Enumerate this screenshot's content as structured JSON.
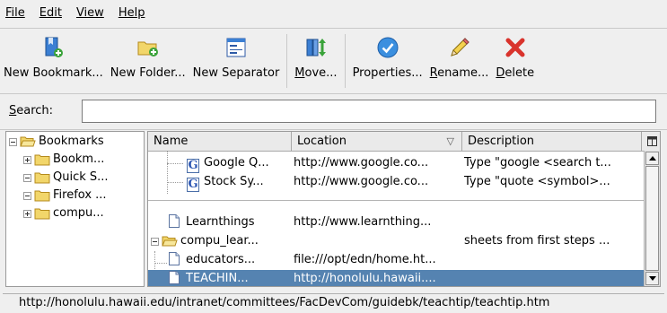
{
  "menubar": {
    "file": "File",
    "edit": "Edit",
    "view": "View",
    "help": "Help"
  },
  "toolbar": {
    "new_bookmark": "New Bookmark...",
    "new_folder": "New Folder...",
    "new_separator": "New Separator",
    "move": "Move...",
    "properties": "Properties...",
    "rename": "Rename...",
    "delete": "Delete"
  },
  "search": {
    "label": "Search:",
    "value": ""
  },
  "tree": {
    "root": "Bookmarks",
    "items": [
      "Bookm...",
      "Quick S...",
      "Firefox ...",
      "compu..."
    ]
  },
  "list": {
    "columns": [
      "Name",
      "Location",
      "Description"
    ],
    "sort_indicator": "▽",
    "rows": [
      {
        "name": "Google Q...",
        "location": "http://www.google.co...",
        "description": "Type \"google <search t..."
      },
      {
        "name": "Stock Sy...",
        "location": "http://www.google.co...",
        "description": "Type \"quote <symbol>..."
      },
      {
        "name": "Learnthings",
        "location": "http://www.learnthing...",
        "description": ""
      },
      {
        "name": "compu_lear...",
        "location": "",
        "description": "sheets from first steps ..."
      },
      {
        "name": "educators...",
        "location": "file:///opt/edn/home.ht...",
        "description": ""
      },
      {
        "name": "TEACHIN...",
        "location": "http://honolulu.hawaii....",
        "description": ""
      }
    ]
  },
  "statusbar": {
    "text": "http://honolulu.hawaii.edu/intranet/committees/FacDevCom/guidebk/teachtip/teachtip.htm"
  },
  "colors": {
    "selection": "#5583b1",
    "folder": "#f2d66a",
    "delete": "#d9332c"
  },
  "icons": [
    "new-bookmark-icon",
    "new-folder-icon",
    "new-separator-icon",
    "move-icon",
    "properties-icon",
    "rename-icon",
    "delete-icon",
    "folder-icon",
    "google-bookmark-icon",
    "page-icon"
  ]
}
